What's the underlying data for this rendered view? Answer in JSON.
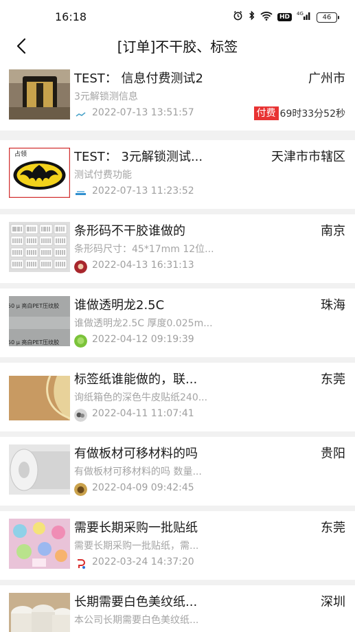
{
  "status_bar": {
    "time": "16:18",
    "battery": "46",
    "icons": [
      "alarm-icon",
      "bluetooth-icon",
      "wifi-icon",
      "hd-icon",
      "signal-icon",
      "battery-icon"
    ],
    "hd": "HD",
    "network": "4G"
  },
  "nav": {
    "back_icon": "chevron-left-icon",
    "title": "[订单]不干胶、标签"
  },
  "colors": {
    "pay_badge": "#e83333",
    "background": "#f1f1f1",
    "card": "#ffffff"
  },
  "items": [
    {
      "title": "TEST： 信息付费测试2",
      "city": "广州市",
      "desc": "3元解锁测信息",
      "date": "2022-07-13 13:51:57",
      "pay_label": "付费",
      "countdown": "69时33分52秒"
    },
    {
      "title": "TEST： 3元解锁测试...",
      "city": "天津市市辖区",
      "desc": "测试付费功能",
      "date": "2022-07-13 11:23:52",
      "thumb_text": "占领"
    },
    {
      "title": "条形码不干胶谁做的",
      "city": "南京",
      "desc": "条形码尺寸：45*17mm 12位...",
      "date": "2022-04-13 16:31:13"
    },
    {
      "title": "谁做透明龙2.5C",
      "city": "珠海",
      "desc": "谁做透明龙2.5C 厚度0.025m...",
      "date": "2022-04-12 09:19:39",
      "thumb_text_1": "50 μ 亮白PET压纹胶",
      "thumb_text_2": "50 μ 亮白PET压纹胶"
    },
    {
      "title": "标签纸谁能做的，联...",
      "city": "东莞",
      "desc": "询纸箱色的深色牛皮贴纸240...",
      "date": "2022-04-11 11:07:41"
    },
    {
      "title": "有做板材可移材料的吗",
      "city": "贵阳",
      "desc": "有做板材可移材料的吗 数量...",
      "date": "2022-04-09 09:42:45"
    },
    {
      "title": "需要长期采购一批贴纸",
      "city": "东莞",
      "desc": "需要长期采购一批贴纸，需...",
      "date": "2022-03-24 14:37:20"
    },
    {
      "title": "长期需要白色美纹纸...",
      "city": "深圳",
      "desc": "本公司长期需要白色美纹纸...",
      "date": ""
    }
  ]
}
